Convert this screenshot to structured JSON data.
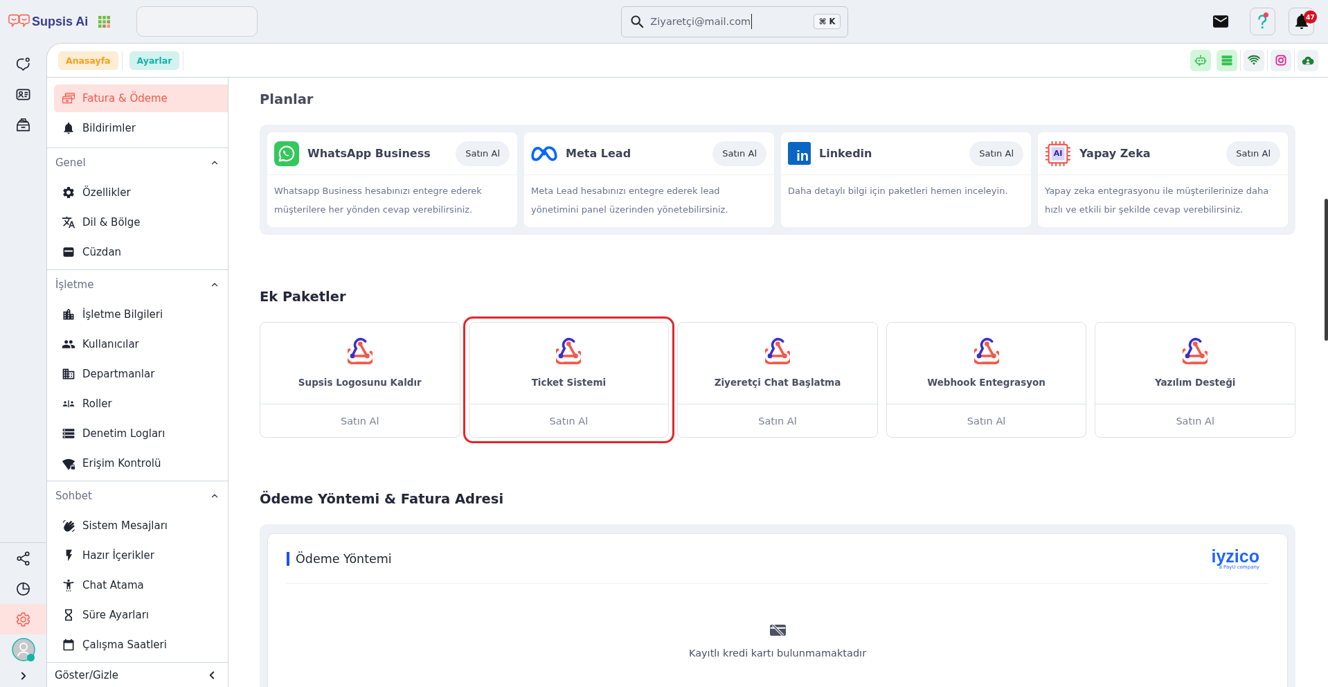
{
  "topbar": {
    "brand": "Supsis Ai",
    "search": {
      "value": "Ziyaretçi@mail.com",
      "shortcut": "⌘ K"
    },
    "help": {
      "unread": true
    },
    "notifications": {
      "count": "47"
    }
  },
  "rail": {
    "top_items": [
      {
        "selected": false
      },
      {
        "selected": false
      },
      {
        "selected": false
      }
    ],
    "bottom_items": [
      {
        "selected": false
      },
      {
        "selected": false
      },
      {
        "selected": true
      }
    ],
    "user": {
      "online": true
    }
  },
  "tabs": [
    {
      "label": "Anasayfa",
      "color": "#f5a11e"
    },
    {
      "label": "Ayarlar",
      "color": "#13b3a8"
    }
  ],
  "channels": [
    {
      "active": true
    },
    {
      "active": true
    },
    {
      "active": false
    },
    {
      "active": false
    },
    {
      "active": false
    }
  ],
  "settings_menu": {
    "top_items": [
      {
        "label": "Fatura & Ödeme",
        "selected": true
      },
      {
        "label": "Bildirimler",
        "selected": false
      }
    ],
    "sections": [
      {
        "title": "Genel",
        "expanded": true,
        "items": [
          {
            "label": "Özellikler",
            "selected": false
          },
          {
            "label": "Dil & Bölge",
            "selected": false
          },
          {
            "label": "Cüzdan",
            "selected": false
          }
        ]
      },
      {
        "title": "İşletme",
        "expanded": true,
        "items": [
          {
            "label": "İşletme Bilgileri",
            "selected": false
          },
          {
            "label": "Kullanıcılar",
            "selected": false
          },
          {
            "label": "Departmanlar",
            "selected": false
          },
          {
            "label": "Roller",
            "selected": false
          },
          {
            "label": "Denetim Logları",
            "selected": false
          },
          {
            "label": "Erişim Kontrolü",
            "selected": false
          }
        ]
      },
      {
        "title": "Sohbet",
        "expanded": true,
        "items": [
          {
            "label": "Sistem Mesajları",
            "selected": false
          },
          {
            "label": "Hazır İçerikler",
            "selected": false
          },
          {
            "label": "Chat Atama",
            "selected": false
          },
          {
            "label": "Süre Ayarları",
            "selected": false
          },
          {
            "label": "Çalışma Saatleri",
            "selected": false
          }
        ]
      }
    ],
    "footer": "Göster/Gizle"
  },
  "plans": {
    "title": "Planlar",
    "items": [
      {
        "kind": "whatsapp",
        "title": "WhatsApp Business",
        "button": "Satın Al",
        "description": "Whatsapp Business hesabınızı entegre ederek müşterilere her yönden cevap verebilirsiniz."
      },
      {
        "kind": "meta",
        "title": "Meta Lead",
        "button": "Satın Al",
        "description": "Meta Lead hesabınızı entegre ederek lead yönetimini panel üzerinden yönetebilirsiniz."
      },
      {
        "kind": "linkedin",
        "logo_text": "in",
        "title": "Linkedin",
        "button": "Satın Al",
        "description": "Daha detaylı bilgi için paketleri hemen inceleyin."
      },
      {
        "kind": "chip",
        "logo_text": "AI",
        "title": "Yapay Zeka",
        "button": "Satın Al",
        "description": "Yapay zeka entegrasyonu ile müşterilerinize daha hızlı ve etkili bir şekilde cevap verebilirsiniz."
      }
    ]
  },
  "packages": {
    "title": "Ek Paketler",
    "items": [
      {
        "title": "Supsis Logosunu Kaldır",
        "button": "Satın Al",
        "highlighted": false
      },
      {
        "title": "Ticket Sistemi",
        "button": "Satın Al",
        "highlighted": true
      },
      {
        "title": "Ziyeretçi Chat Başlatma",
        "button": "Satın Al",
        "highlighted": false
      },
      {
        "title": "Webhook Entegrasyon",
        "button": "Satın Al",
        "highlighted": false
      },
      {
        "title": "Yazılım Desteği",
        "button": "Satın Al",
        "highlighted": false
      }
    ]
  },
  "payment": {
    "title": "Ödeme Yöntemi & Fatura Adresi",
    "card_title": "Ödeme Yöntemi",
    "provider": {
      "name": "iyzico",
      "tagline": "a PayU company"
    },
    "empty_text": "Kayıtlı kredi kartı bulunmamaktadır"
  }
}
